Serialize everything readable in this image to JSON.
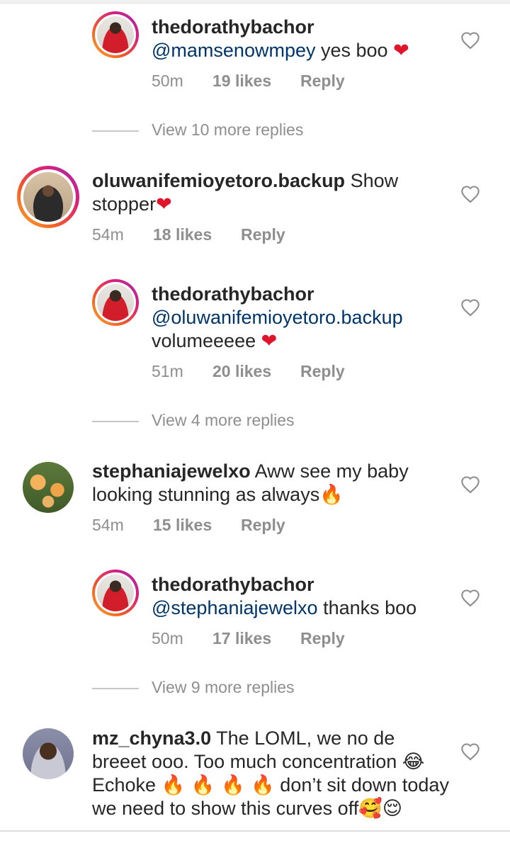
{
  "comments": [
    {
      "username": "thedorathybachor",
      "mention": "@mamsenowmpey",
      "text": " yes boo ",
      "emoji": "❤",
      "time": "50m",
      "likes": "19 likes",
      "reply": "Reply"
    },
    {
      "username": "oluwanifemioyetoro.backup",
      "text_line1": " Show",
      "text_line2": "stopper",
      "emoji": "❤",
      "time": "54m",
      "likes": "18 likes",
      "reply": "Reply"
    },
    {
      "username": "thedorathybachor",
      "mention": "@oluwanifemioyetoro.backup",
      "text": "volumeeeee ",
      "emoji": "❤",
      "time": "51m",
      "likes": "20 likes",
      "reply": "Reply"
    },
    {
      "username": "stephaniajewelxo",
      "text_line1": " Aww see my baby",
      "text_line2": "looking stunning as always",
      "emoji": "🔥",
      "time": "54m",
      "likes": "15 likes",
      "reply": "Reply"
    },
    {
      "username": "thedorathybachor",
      "mention": "@stephaniajewelxo",
      "text": " thanks boo",
      "time": "50m",
      "likes": "17 likes",
      "reply": "Reply"
    },
    {
      "username": "mz_chyna3.0",
      "text_line1": " The LOML, we no de",
      "text_line2": "breeet ooo. Too much concentration ",
      "emoji_line2": "😂",
      "text_line3a": "Echoke ",
      "emoji_line3": "🔥 🔥 🔥 🔥",
      "text_line3b": " don’t sit down today",
      "text_line4": "we need to show this curves off",
      "emoji_line4": "🥰😌"
    }
  ],
  "view_more": [
    "View 10 more replies",
    "View 4 more replies",
    "View 9 more replies"
  ],
  "colors": {
    "text": "#262626",
    "meta": "#8e8e8e",
    "mention": "#003569",
    "story_ring_start": "#f9b02b",
    "story_ring_end": "#a02bb5"
  },
  "icons": {
    "like": "heart-outline-icon"
  }
}
